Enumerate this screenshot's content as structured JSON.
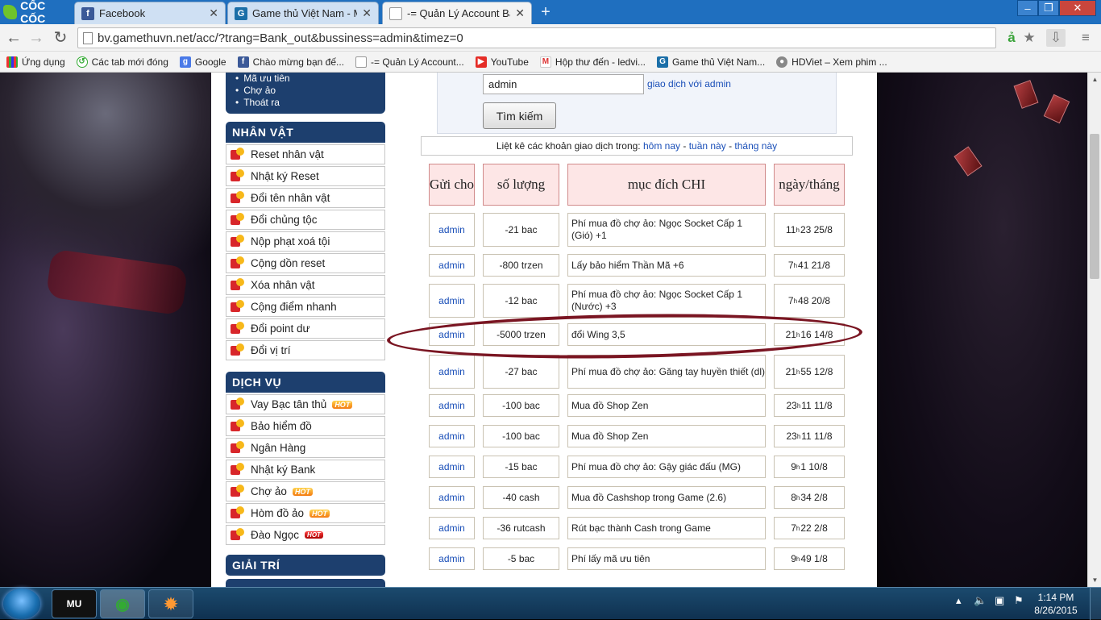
{
  "browser": {
    "brand": "CỐC CỐC",
    "tabs": [
      {
        "title": "Facebook",
        "icon": "facebook-icon",
        "active": false
      },
      {
        "title": "Game thủ Việt Nam - MU O",
        "icon": "gamethu-icon",
        "active": false
      },
      {
        "title": "-= Quản Lý Account Bá Vư",
        "icon": "page-icon",
        "active": true
      }
    ],
    "url": "bv.gamethuvn.net/acc/?trang=Bank_out&bussiness=admin&timez=0",
    "bookmarks": [
      {
        "label": "Ứng dụng",
        "icon": "apps-grid-icon"
      },
      {
        "label": "Các tab mới đóng",
        "icon": "history-icon"
      },
      {
        "label": "Google",
        "icon": "google-icon"
      },
      {
        "label": "Chào mừng bạn đế...",
        "icon": "facebook-icon"
      },
      {
        "label": "-= Quản Lý Account...",
        "icon": "page-icon"
      },
      {
        "label": "YouTube",
        "icon": "youtube-icon"
      },
      {
        "label": "Hộp thư đến - ledvi...",
        "icon": "gmail-icon"
      },
      {
        "label": "Game thủ Việt Nam...",
        "icon": "gamethu-icon"
      },
      {
        "label": "HDViet – Xem phim ...",
        "icon": "hdviet-icon"
      }
    ]
  },
  "sidebar": {
    "top_links": [
      "Mã ưu tiên",
      "Chợ ảo",
      "Thoát ra"
    ],
    "sections": [
      {
        "title": "NHÂN VẬT",
        "items": [
          {
            "label": "Reset nhân vật"
          },
          {
            "label": "Nhật ký Reset"
          },
          {
            "label": "Đổi tên nhân vật"
          },
          {
            "label": "Đổi chủng tộc"
          },
          {
            "label": "Nộp phạt xoá tội"
          },
          {
            "label": "Cộng dồn reset"
          },
          {
            "label": "Xóa nhân vật"
          },
          {
            "label": "Cộng điểm nhanh"
          },
          {
            "label": "Đổi point dư"
          },
          {
            "label": "Đổi vị trí"
          }
        ]
      },
      {
        "title": "DỊCH VỤ",
        "items": [
          {
            "label": "Vay Bạc tân thủ",
            "badge": "HOT"
          },
          {
            "label": "Bảo hiểm đồ"
          },
          {
            "label": "Ngân Hàng"
          },
          {
            "label": "Nhật ký Bank"
          },
          {
            "label": "Chợ ảo",
            "badge": "HOT"
          },
          {
            "label": "Hòm đồ ảo",
            "badge": "HOT"
          },
          {
            "label": "Đào Ngọc",
            "badge": "HOT"
          }
        ]
      },
      {
        "title": "GIẢI TRÍ",
        "items": []
      }
    ]
  },
  "search": {
    "value": "admin",
    "link": "giao dịch với admin",
    "button": "Tìm kiếm"
  },
  "period": {
    "prefix": "Liệt kê các khoản giao dịch trong:",
    "today": "hôm nay",
    "sep1": " - ",
    "week": "tuần này",
    "sep2": " - ",
    "month": "tháng này"
  },
  "table": {
    "headers": [
      "Gửi cho",
      "số lượng",
      "mục đích CHI",
      "ngày/tháng"
    ],
    "rows": [
      {
        "user": "admin",
        "amount": "-21  bac",
        "desc": "Phí mua đồ chợ ảo: Ngọc Socket Cấp 1 (Gió) +1",
        "hh": "11",
        "rest": "23 25/8",
        "circled": false
      },
      {
        "user": "admin",
        "amount": "-800  trzen",
        "desc": "Lấy bảo hiểm Thần Mã +6",
        "hh": "7",
        "rest": "41 21/8",
        "circled": false
      },
      {
        "user": "admin",
        "amount": "-12  bac",
        "desc": "Phí mua đồ chợ ảo: Ngọc Socket Cấp 1 (Nước) +3",
        "hh": "7",
        "rest": "48 20/8",
        "circled": false
      },
      {
        "user": "admin",
        "amount": "-5000  trzen",
        "desc": "đổi Wing 3,5",
        "hh": "21",
        "rest": "16 14/8",
        "circled": true
      },
      {
        "user": "admin",
        "amount": "-27  bac",
        "desc": "Phí mua đồ chợ ảo: Găng tay huyền thiết (dl)",
        "hh": "21",
        "rest": "55 12/8",
        "circled": false
      },
      {
        "user": "admin",
        "amount": "-100  bac",
        "desc": "Mua đồ Shop Zen",
        "hh": "23",
        "rest": "11 11/8",
        "circled": false
      },
      {
        "user": "admin",
        "amount": "-100  bac",
        "desc": "Mua đồ Shop Zen",
        "hh": "23",
        "rest": "11 11/8",
        "circled": false
      },
      {
        "user": "admin",
        "amount": "-15  bac",
        "desc": "Phí mua đồ chợ ảo: Gậy giác đấu (MG)",
        "hh": "9",
        "rest": "1 10/8",
        "circled": false
      },
      {
        "user": "admin",
        "amount": "-40  cash",
        "desc": "Mua đồ Cashshop trong Game (2.6)",
        "hh": "8",
        "rest": "34 2/8",
        "circled": false
      },
      {
        "user": "admin",
        "amount": "-36  rutcash",
        "desc": "Rút bạc thành Cash trong Game",
        "hh": "7",
        "rest": "22 2/8",
        "circled": false
      },
      {
        "user": "admin",
        "amount": "-5  bac",
        "desc": "Phí lấy mã ưu tiên",
        "hh": "9",
        "rest": "49 1/8",
        "circled": false
      }
    ]
  },
  "taskbar": {
    "apps": [
      "MU",
      "Cốc Cốc",
      "Game"
    ],
    "time": "1:14 PM",
    "date": "8/26/2015"
  },
  "colors": {
    "menu_bg": "#1d3f6e",
    "link": "#1a4fb8",
    "header_bg": "#fde6e6",
    "circle": "#7a1522",
    "tab_strip": "#1f6fbf"
  }
}
